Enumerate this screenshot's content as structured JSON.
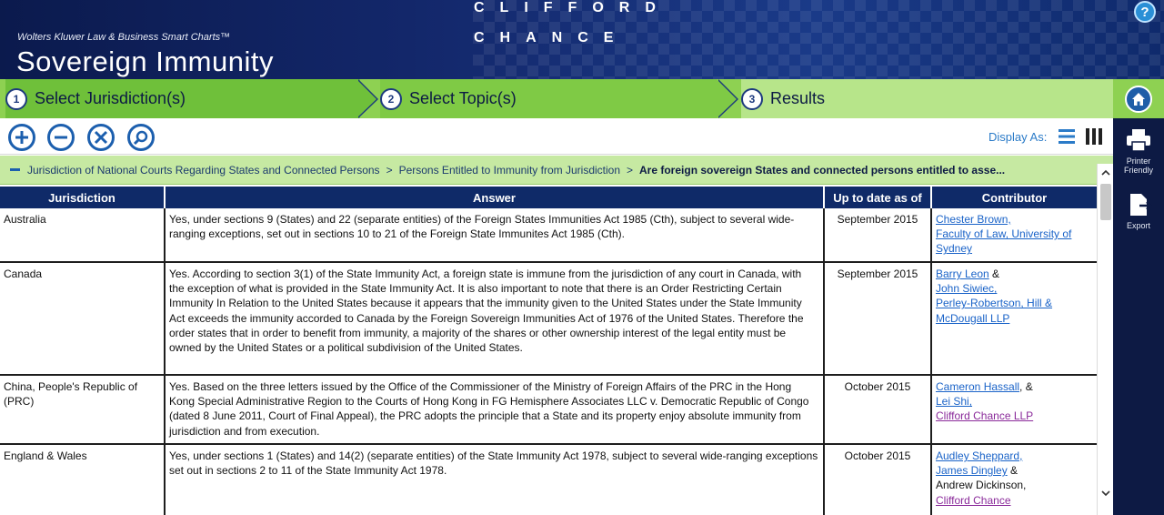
{
  "header": {
    "brand": "Wolters Kluwer Law & Business Smart Charts™",
    "title": "Sovereign Immunity",
    "logo_line1": "CLIFFORD",
    "logo_line2": "CHANCE",
    "help_label": "?"
  },
  "steps": [
    {
      "num": "1",
      "label": "Select Jurisdiction(s)"
    },
    {
      "num": "2",
      "label": "Select Topic(s)"
    },
    {
      "num": "3",
      "label": "Results"
    }
  ],
  "sidebar": {
    "printer_label_1": "Printer",
    "printer_label_2": "Friendly",
    "export_label": "Export"
  },
  "toolbar": {
    "display_as": "Display As:"
  },
  "breadcrumb": {
    "item1": "Jurisdiction of National Courts Regarding States and Connected Persons",
    "sep": ">",
    "item2": "Persons Entitled to Immunity from Jurisdiction",
    "current": "Are foreign sovereign States and connected persons entitled to asse..."
  },
  "table": {
    "columns": [
      "Jurisdiction",
      "Answer",
      "Up to date as of",
      "Contributor"
    ],
    "rows": [
      {
        "jurisdiction": "Australia",
        "answer": "Yes, under sections 9 (States) and 22 (separate entities) of the Foreign States Immunities Act 1985 (Cth), subject to several wide-ranging exceptions, set out in sections 10 to 21 of the Foreign State Immunites Act 1985 (Cth).",
        "date": "September 2015",
        "contributors": [
          {
            "text": "Chester Brown,",
            "type": "link"
          },
          {
            "text": "Faculty of Law, University of Sydney",
            "type": "link"
          }
        ]
      },
      {
        "jurisdiction": "Canada",
        "answer": "Yes. According to section 3(1) of the State Immunity Act, a foreign state is immune from the jurisdiction of any court in Canada, with the exception of what is provided in the State Immunity Act. It is also important to note that there is an Order Restricting Certain Immunity In Relation to the United States because it appears that the immunity given to the United States under the State Immunity Act exceeds the immunity accorded to Canada by the Foreign Sovereign Immunities Act of 1976 of the United States. Therefore the order states that in order to benefit from immunity, a majority of the shares or other ownership interest of the legal entity must be owned by the United States or a political subdivision of the United States.",
        "date": "September 2015",
        "contributors": [
          {
            "text": "Barry Leon",
            "type": "link",
            "suffix": " &"
          },
          {
            "text": "John Siwiec,",
            "type": "link"
          },
          {
            "text": "Perley-Robertson, Hill & McDougall LLP",
            "type": "link"
          }
        ]
      },
      {
        "jurisdiction": "China, People's Republic of (PRC)",
        "answer": "Yes. Based on the three letters issued by the Office of the Commissioner of the Ministry of Foreign Affairs of the PRC in the Hong Kong Special Administrative Region to the Courts of Hong Kong in FG Hemisphere Associates LLC v. Democratic Republic of Congo (dated 8 June 2011, Court of Final Appeal), the PRC adopts the principle that a State and its property enjoy absolute immunity from jurisdiction and from execution.",
        "date": "October 2015",
        "contributors": [
          {
            "text": "Cameron Hassall",
            "type": "link",
            "suffix": ", &"
          },
          {
            "text": "Lei Shi,",
            "type": "link"
          },
          {
            "text": "Clifford Chance LLP",
            "type": "visited"
          }
        ]
      },
      {
        "jurisdiction": "England & Wales",
        "answer": "Yes, under sections 1 (States) and 14(2) (separate entities) of the State Immunity Act 1978, subject to several wide-ranging exceptions set out in sections 2 to 11 of the State Immunity Act 1978.",
        "date": "October 2015",
        "contributors": [
          {
            "text": "Audley Sheppard,",
            "type": "link"
          },
          {
            "text": "James Dingley",
            "type": "link",
            "suffix": " &"
          },
          {
            "text": "Andrew Dickinson,",
            "type": "plain"
          },
          {
            "text": "Clifford Chance",
            "type": "visited"
          }
        ]
      }
    ]
  }
}
